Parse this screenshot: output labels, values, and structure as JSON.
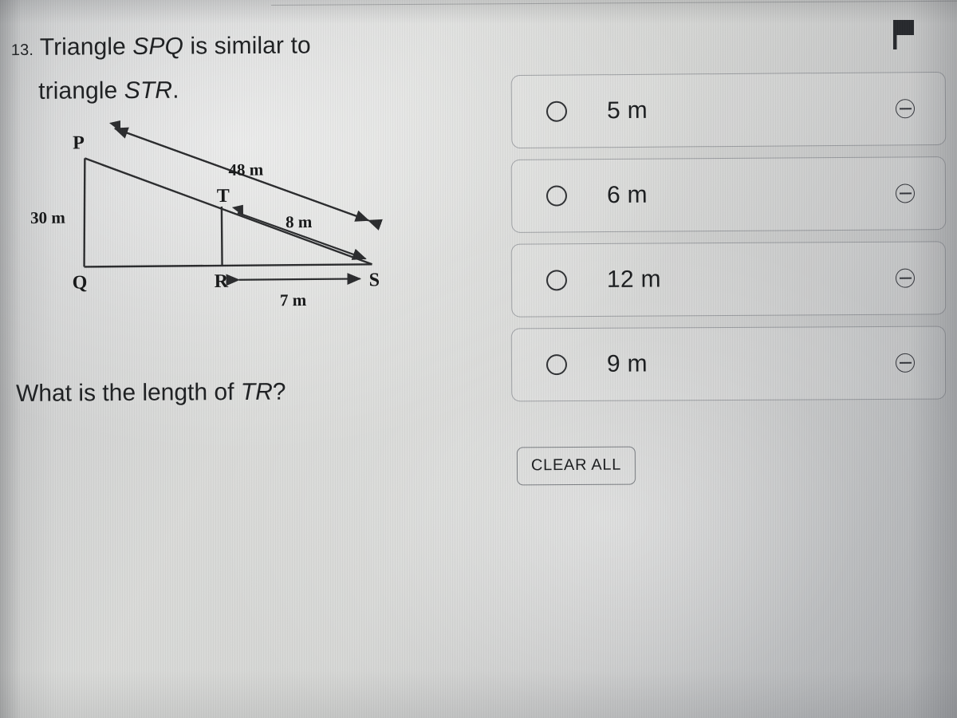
{
  "question": {
    "number": "13.",
    "line1_prefix": "Triangle ",
    "line1_italic": "SPQ",
    "line1_suffix": " is similar to",
    "line2_prefix": "triangle ",
    "line2_italic": "STR",
    "line2_suffix": ".",
    "final_prefix": "What is the length of ",
    "final_italic": "TR",
    "final_suffix": "?"
  },
  "diagram": {
    "vertices": [
      "P",
      "Q",
      "R",
      "S",
      "T"
    ],
    "label_p": "P",
    "label_q": "Q",
    "label_r": "R",
    "label_s": "S",
    "label_t": "T",
    "measure_pq": "30 m",
    "measure_ps": "48 m",
    "measure_ts": "8 m",
    "measure_rs": "7 m"
  },
  "options": [
    {
      "label": "5 m",
      "radio_name": "radio-5m",
      "eliminate_name": "eliminate-5m"
    },
    {
      "label": "6 m",
      "radio_name": "radio-6m",
      "eliminate_name": "eliminate-6m"
    },
    {
      "label": "12 m",
      "radio_name": "radio-12m",
      "eliminate_name": "eliminate-12m"
    },
    {
      "label": "9 m",
      "radio_name": "radio-9m",
      "eliminate_name": "eliminate-9m"
    }
  ],
  "toolbar": {
    "clear_all_label": "CLEAR ALL",
    "flag_icon": "flag-icon"
  },
  "colors": {
    "text": "#1d1f21",
    "card_border": "#6c7076",
    "ink": "#2a2b2d",
    "flag": "#26282c"
  }
}
